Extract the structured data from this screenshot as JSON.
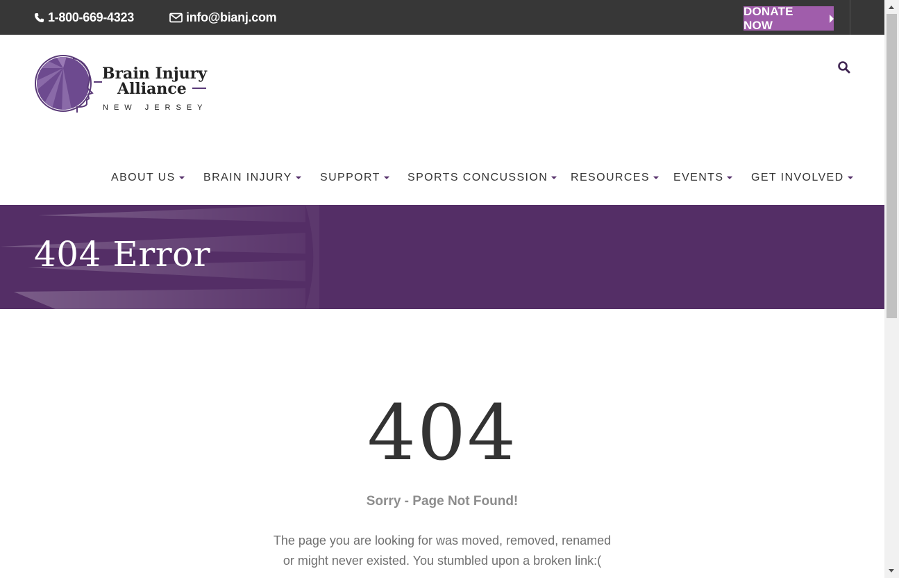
{
  "topbar": {
    "phone": "1-800-669-4323",
    "email": "info@bianj.com",
    "donate_label": "DONATE NOW",
    "background": "#373737"
  },
  "logo": {
    "line1": "Brain Injury",
    "line2": "Alliance",
    "line3": "NEW JERSEY"
  },
  "nav": {
    "items": [
      {
        "label": "ABOUT US"
      },
      {
        "label": "BRAIN INJURY"
      },
      {
        "label": "SUPPORT"
      },
      {
        "label": "SPORTS CONCUSSION"
      },
      {
        "label": "RESOURCES"
      },
      {
        "label": "EVENTS"
      },
      {
        "label": "GET INVOLVED"
      }
    ]
  },
  "banner": {
    "title": "404 Error",
    "color": "#542e66"
  },
  "content": {
    "code": "404",
    "headline": "Sorry - Page Not Found!",
    "line1": "The page you are looking for was moved, removed, renamed",
    "line2": "or might never existed. You stumbled upon a broken link:("
  },
  "colors": {
    "accent": "#a05dab",
    "brand": "#542e66"
  },
  "icons": {
    "phone": "phone-icon",
    "email": "envelope-icon",
    "search": "search-icon",
    "caret": "caret-down-icon"
  }
}
